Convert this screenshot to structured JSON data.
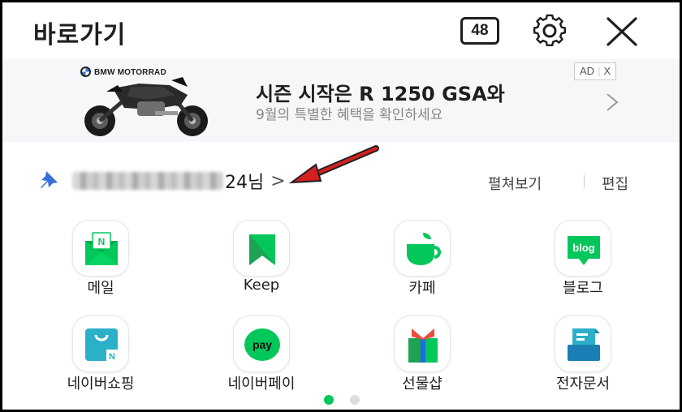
{
  "header": {
    "title": "바로가기",
    "count": "48"
  },
  "ad": {
    "brand": "BMW MOTORRAD",
    "headline": "시즌 시작은 R 1250 GSA와",
    "subtext": "9월의 특별한 혜택을 확인하세요",
    "tag_ad": "AD",
    "tag_close": "X"
  },
  "user": {
    "name_suffix": "24님",
    "chevron": ">",
    "view_all": "펼쳐보기",
    "edit": "편집"
  },
  "apps": [
    {
      "label": "메일",
      "icon": "mail-icon"
    },
    {
      "label": "Keep",
      "icon": "keep-icon"
    },
    {
      "label": "카페",
      "icon": "cafe-icon"
    },
    {
      "label": "블로그",
      "icon": "blog-icon"
    },
    {
      "label": "네이버쇼핑",
      "icon": "shopping-icon"
    },
    {
      "label": "네이버페이",
      "icon": "pay-icon"
    },
    {
      "label": "선물샵",
      "icon": "gift-icon"
    },
    {
      "label": "전자문서",
      "icon": "document-icon"
    }
  ],
  "icon_text": {
    "mail": "N",
    "blog": "blog",
    "shopping": "N",
    "pay": "pay"
  },
  "pager": {
    "pages": 2,
    "active": 1
  },
  "colors": {
    "naver_green": "#03c75a",
    "text": "#1e1e1e",
    "pin_blue": "#3b6fd8",
    "annotation_red": "#d41f1f"
  }
}
